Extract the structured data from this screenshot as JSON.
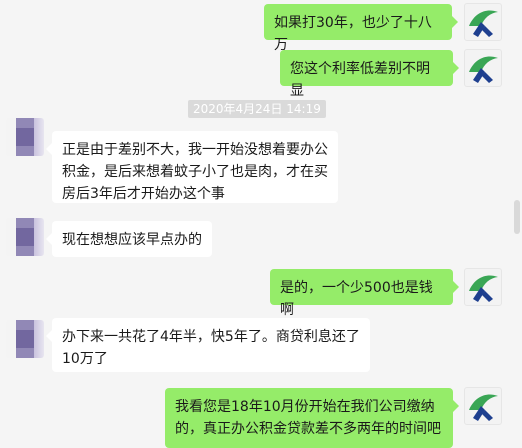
{
  "messages": [
    {
      "side": "mine",
      "text": "如果打30年，也少了十八万"
    },
    {
      "side": "mine",
      "text": "您这个利率低差别不明显"
    },
    {
      "side": "other",
      "text": "正是由于差别不大，我一开始没想着要办公积金，是后来想着蚊子小了也是肉，才在买房后3年后才开始办这个事"
    },
    {
      "side": "other",
      "text": "现在想想应该早点办的"
    },
    {
      "side": "mine",
      "text": "是的，一个少500也是钱啊"
    },
    {
      "side": "other",
      "text": "办下来一共花了4年半，快5年了。商贷利息还了10万了"
    },
    {
      "side": "mine",
      "text": "我看您是18年10月份开始在我们公司缴纳的，真正办公积金贷款差不多两年的时间吧"
    }
  ],
  "timestamp": "2020年4月24日 14:19",
  "icons": {
    "mine_avatar": "bird-logo-icon",
    "other_avatar": "blurred-avatar"
  },
  "colors": {
    "mine_bubble": "#95ec69",
    "other_bubble": "#ffffff",
    "background": "#f5f5f5",
    "logo_green": "#3aa655",
    "logo_blue": "#1e3f8f"
  }
}
